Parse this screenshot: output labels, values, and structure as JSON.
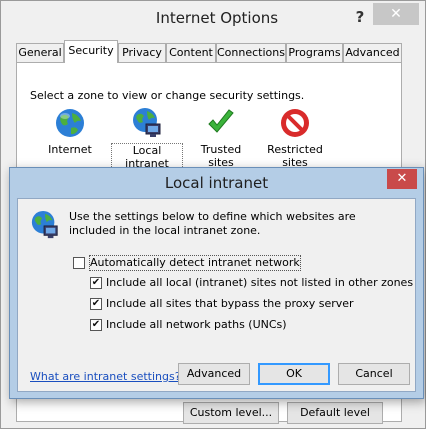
{
  "window": {
    "title": "Internet Options",
    "help_label": "?",
    "close_label": "✕"
  },
  "tabs": [
    {
      "label": "General"
    },
    {
      "label": "Security",
      "active": true
    },
    {
      "label": "Privacy"
    },
    {
      "label": "Content"
    },
    {
      "label": "Connections"
    },
    {
      "label": "Programs"
    },
    {
      "label": "Advanced"
    }
  ],
  "security": {
    "prompt": "Select a zone to view or change security settings.",
    "zones": [
      {
        "label": "Internet",
        "icon": "globe-icon"
      },
      {
        "label": "Local intranet",
        "icon": "intranet-globe-icon",
        "selected": true
      },
      {
        "label": "Trusted sites",
        "icon": "green-check-icon"
      },
      {
        "label": "Restricted sites",
        "icon": "no-entry-icon"
      }
    ],
    "custom_level_label": "Custom level...",
    "default_level_label": "Default level"
  },
  "dialog": {
    "title": "Local intranet",
    "close_label": "✕",
    "description": "Use the settings below to define which websites are included in the local intranet zone.",
    "options": [
      {
        "label": "Automatically detect intranet network",
        "checked": false
      },
      {
        "label": "Include all local (intranet) sites not listed in other zones",
        "checked": true
      },
      {
        "label": "Include all sites that bypass the proxy server",
        "checked": true
      },
      {
        "label": "Include all network paths (UNCs)",
        "checked": true
      }
    ],
    "link_label": "What are intranet settings?",
    "advanced_label": "Advanced",
    "ok_label": "OK",
    "cancel_label": "Cancel"
  },
  "colors": {
    "dialog_frame": "#b4cde6",
    "close_button": "#c94a4a",
    "link": "#1a4fbf",
    "default_button_border": "#3399ff"
  }
}
